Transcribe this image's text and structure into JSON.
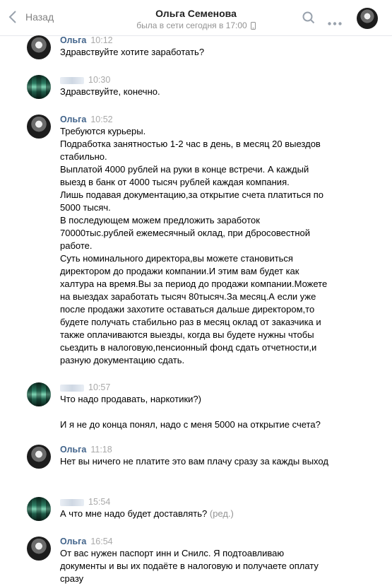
{
  "header": {
    "back_label": "Назад",
    "contact_name": "Ольга Семенова",
    "status": "была в сети сегодня в 17:00"
  },
  "messages": [
    {
      "author": "Ольга",
      "time": "10:12",
      "lines": [
        "Здравствуйте хотите заработать?"
      ]
    },
    {
      "author": "",
      "time": "10:30",
      "lines": [
        "Здравствуйте, конечно."
      ]
    },
    {
      "author": "Ольга",
      "time": "10:52",
      "lines": [
        "Требуются курьеры.",
        "Подработка занятностью 1-2 час в день, в месяц 20 выездов стабильно.",
        "Выплатой 4000 рублей на руки в конце встречи. А каждый выезд в банк от 4000 тысяч рублей каждая компания.",
        "Лишь подавая документацию,за открытие счета платиться по 5000 тысяч.",
        "В последующем можем предложить заработок 70000тыс.рублей ежемесячный оклад, при дбросовестной работе.",
        "Суть номинального директора,вы можете становиться директором до продажи компании.И этим вам будет как халтура на время.Вы за период до продажи компании.Можете на выездах заработать тысяч 80тысяч.За месяц.А если уже после продажи захотите оставаться дальше директором,то будете получать стабильно раз в месяц оклад от заказчика и также оплачиваются выезды, когда вы будете нужны чтобы сьездить в налоговую,пенсионный фонд сдать отчетности,и разную документацию сдать."
      ]
    },
    {
      "author": "",
      "time": "10:57",
      "lines": [
        "Что надо продавать, наркотики?)",
        "",
        "И я не до конца понял, надо с меня 5000 на открытие счета?"
      ]
    },
    {
      "author": "Ольга",
      "time": "11:18",
      "lines": [
        "Нет вы ничего не платите это вам плачу сразу за кажды выход"
      ]
    },
    {
      "author": "",
      "time": "15:54",
      "lines": [
        "А что мне надо будет доставлять?"
      ],
      "edited": "(ред.)"
    },
    {
      "author": "Ольга",
      "time": "16:54",
      "lines": [
        "От вас нужен паспорт инн и Снилс. Я подтоавливаю документы и вы их подаёте в налоговую и получаете оплату сразу"
      ]
    }
  ]
}
